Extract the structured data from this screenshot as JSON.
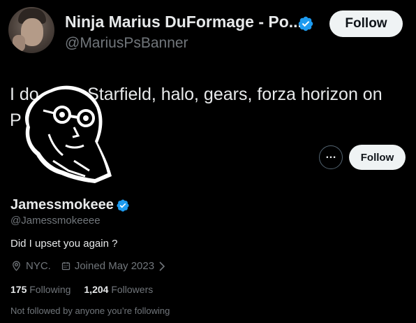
{
  "background_tweet": {
    "author_name": "Ninja Marius DuFormage - Po...",
    "author_handle": "@MariusPsBanner",
    "follow_label": "Follow",
    "text_line1": "I do          Starfield, halo, gears, forza horizon on",
    "text_line2": "P"
  },
  "hover_card": {
    "display_name": "Jamessmokeee",
    "handle": "@Jamessmokeeee",
    "bio": "Did I upset you again ?",
    "location": "NYC.",
    "joined": "Joined May 2023",
    "follow_label": "Follow",
    "more_label": "…",
    "stats": {
      "following_count": "175",
      "following_label": "Following",
      "followers_count": "1,204",
      "followers_label": "Followers"
    },
    "not_followed": "Not followed by anyone you’re following"
  },
  "colors": {
    "background": "#000000",
    "primary_text": "#e7e9ea",
    "secondary_text": "#71767b",
    "verified_blue": "#1d9bf0",
    "button_bg": "#eff3f4"
  },
  "icons": {
    "verified": "verified-badge-icon",
    "location": "location-pin-icon",
    "calendar": "calendar-icon",
    "more": "ellipsis-icon",
    "chevron": "chevron-right-icon"
  }
}
